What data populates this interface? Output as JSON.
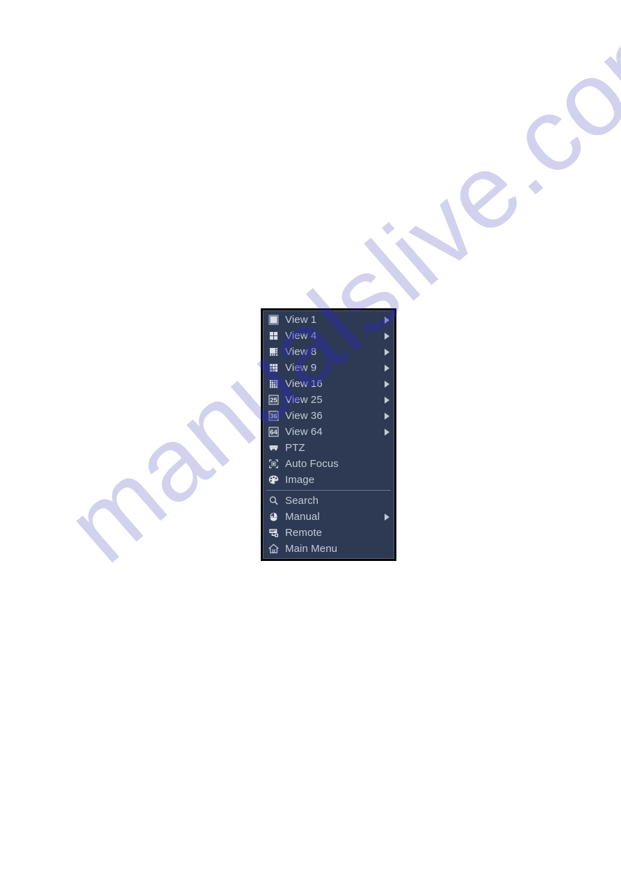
{
  "page": {
    "background_color": "#ffffff",
    "watermark": {
      "text": "manualslive.com",
      "color": "#d2d2ef"
    }
  },
  "context_menu": {
    "name": "preview-right-click-menu",
    "background_color": "#2e3a54",
    "border_color": "#000000",
    "text_color": "#c3cad8",
    "separator_color": "#6e768c",
    "groups": [
      {
        "name": "view-group",
        "items": [
          {
            "label": "View 1",
            "icon": "view-1-icon",
            "has_submenu": true
          },
          {
            "label": "View 4",
            "icon": "view-4-icon",
            "has_submenu": true
          },
          {
            "label": "View 8",
            "icon": "view-8-icon",
            "has_submenu": true
          },
          {
            "label": "View 9",
            "icon": "view-9-icon",
            "has_submenu": true
          },
          {
            "label": "View 16",
            "icon": "view-16-icon",
            "has_submenu": true
          },
          {
            "label": "View 25",
            "icon": "view-25-icon",
            "has_submenu": true
          },
          {
            "label": "View 36",
            "icon": "view-36-icon",
            "has_submenu": true
          },
          {
            "label": "View 64",
            "icon": "view-64-icon",
            "has_submenu": true
          },
          {
            "label": "PTZ",
            "icon": "ptz-camera-icon",
            "has_submenu": false
          },
          {
            "label": "Auto Focus",
            "icon": "auto-focus-icon",
            "has_submenu": false
          },
          {
            "label": "Image",
            "icon": "palette-icon",
            "has_submenu": false
          }
        ]
      },
      {
        "name": "system-group",
        "items": [
          {
            "label": "Search",
            "icon": "search-magnifier-icon",
            "has_submenu": false
          },
          {
            "label": "Manual",
            "icon": "mouse-icon",
            "has_submenu": true
          },
          {
            "label": "Remote",
            "icon": "remote-device-icon",
            "has_submenu": false
          },
          {
            "label": "Main Menu",
            "icon": "home-house-icon",
            "has_submenu": false
          }
        ]
      }
    ],
    "icon_badge_numbers": {
      "view_25": "25",
      "view_36": "36",
      "view_64": "64"
    }
  }
}
